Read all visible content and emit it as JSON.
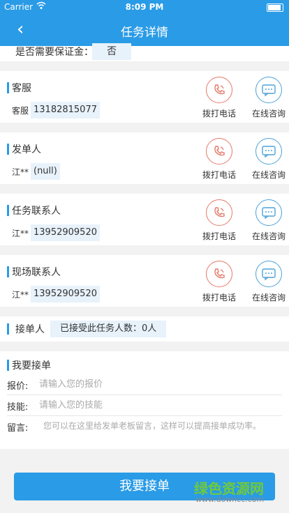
{
  "statusbar": {
    "carrier": "Carrier",
    "time": "8:09 PM"
  },
  "navbar": {
    "back_glyph": "‹",
    "title": "任务详情"
  },
  "partial": {
    "label": "是否需要保证金：",
    "value": "否"
  },
  "contacts": [
    {
      "title": "客服",
      "person": "客服",
      "phone": "13182815077"
    },
    {
      "title": "发单人",
      "person": "江**",
      "phone": "(null)"
    },
    {
      "title": "任务联系人",
      "person": "江**",
      "phone": "13952909520"
    },
    {
      "title": "现场联系人",
      "person": "江**",
      "phone": "13952909520"
    }
  ],
  "actions": {
    "call": "拨打电话",
    "chat": "在线咨询"
  },
  "taker": {
    "title": "接单人",
    "count_text": "已接受此任务人数：0人"
  },
  "form": {
    "title": "我要接单",
    "price_label": "报价:",
    "price_placeholder": "请输入您的报价",
    "skill_label": "技能:",
    "skill_placeholder": "请输入您的技能",
    "message_label": "留言:",
    "message_placeholder": "您可以在这里给发单老板留言，这样可以提高接单成功率。"
  },
  "submit_label": "我要接单",
  "watermark": {
    "line1": "绿色资源网",
    "line2": "www.downcc.com"
  },
  "icons": {
    "call": "phone-icon",
    "chat": "chat-bubble-icon"
  },
  "colors": {
    "primary": "#2a9be6",
    "call": "#e57a6a",
    "chat": "#4ca3d8"
  }
}
